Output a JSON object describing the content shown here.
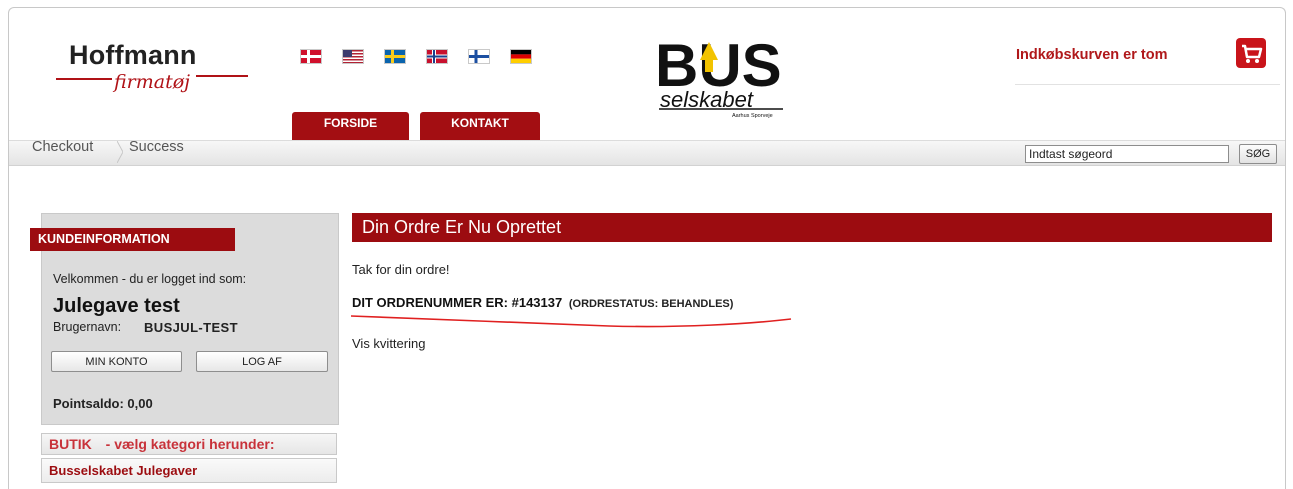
{
  "header": {
    "logo_brand": "Hoffmann",
    "logo_sub": "firmatøj",
    "languages": [
      "Dansk",
      "English",
      "Svenska",
      "Norsk",
      "Suomi",
      "Deutsch"
    ],
    "nav": [
      {
        "label": "FORSIDE"
      },
      {
        "label": "KONTAKT"
      }
    ],
    "partner_logo": {
      "main": "BUS",
      "sub": "selskabet",
      "caption": "Aarhus Sporveje"
    },
    "cart_text": "Indkøbskurven er tom",
    "cart_icon": "shopping-cart-icon"
  },
  "breadcrumb": [
    "Checkout",
    "Success"
  ],
  "search": {
    "value": "Indtast søgeord",
    "button": "SØG"
  },
  "sidebar": {
    "heading": "KUNDEINFORMATION",
    "welcome": "Velkommen - du er logget ind som:",
    "user_name": "Julegave test",
    "login_label": "Brugernavn:",
    "login_value": "BUSJUL-TEST",
    "account_button": "MIN KONTO",
    "logout_button": "LOG AF",
    "points": "Pointsaldo: 0,00",
    "shop_label": "BUTIK",
    "shop_hint": "- vælg kategori herunder:",
    "categories": [
      "Busselskabet Julegaver"
    ]
  },
  "main": {
    "heading": "Din Ordre Er Nu Oprettet",
    "thanks": "Tak for din ordre!",
    "order_number": "DIT ORDRENUMMER ER: #143137",
    "order_status": "(ORDRESTATUS: BEHANDLES)",
    "receipt_link": "Vis kvittering"
  },
  "colors": {
    "brand_red": "#9c0c10",
    "cart_text": "#b0181a",
    "cart_icon": "#c9141a",
    "underline": "#e02020"
  }
}
